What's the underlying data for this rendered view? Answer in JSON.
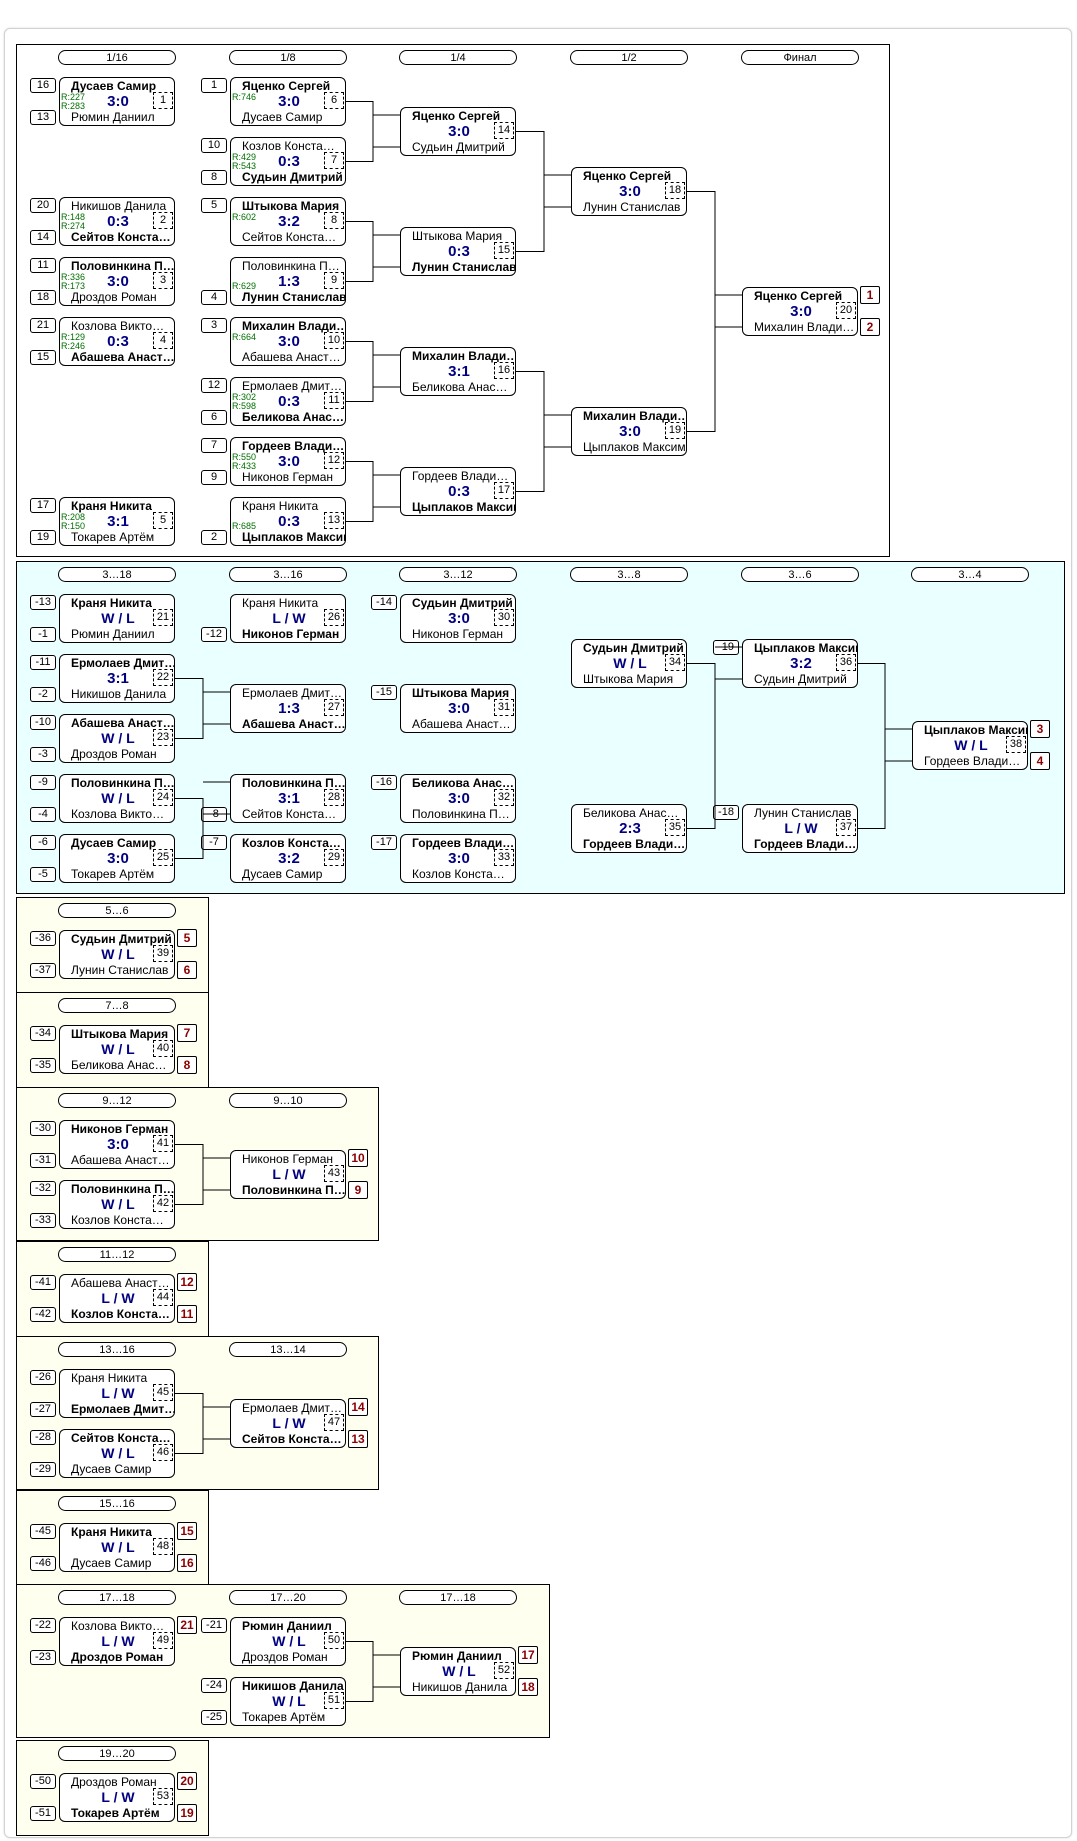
{
  "sections": [
    {
      "bg": "white",
      "rounds": [
        "1/16",
        "1/8",
        "1/4",
        "1/2",
        "Финал"
      ],
      "matches": [
        {
          "t": "Дусаев Самир",
          "tr": "R:227",
          "b": "Рюмин Даниил",
          "br": "R:283",
          "score": "3:0",
          "num": "1",
          "win": "t",
          "ts": "16",
          "bs": "13"
        },
        {
          "t": "Никишов Данила",
          "tr": "R:148",
          "b": "Сейтов Конста…",
          "br": "R:274",
          "score": "0:3",
          "num": "2",
          "win": "b",
          "ts": "20",
          "bs": "14"
        },
        {
          "t": "Половинкина П…",
          "tr": "R:336",
          "b": "Дроздов Роман",
          "br": "R:173",
          "score": "3:0",
          "num": "3",
          "win": "t",
          "ts": "11",
          "bs": "18"
        },
        {
          "t": "Козлова Викто…",
          "tr": "R:129",
          "b": "Абашева Анаст…",
          "br": "R:246",
          "score": "0:3",
          "num": "4",
          "win": "b",
          "ts": "21",
          "bs": "15"
        },
        {
          "t": "Краня Никита",
          "tr": "R:208",
          "b": "Токарев Артём",
          "br": "R:150",
          "score": "3:1",
          "num": "5",
          "win": "t",
          "ts": "17",
          "bs": "19"
        },
        {
          "t": "Яценко Сергей",
          "tr": "R:746",
          "b": "Дусаев Самир",
          "br": "",
          "score": "3:0",
          "num": "6",
          "win": "t",
          "ts": "1",
          "bs": ""
        },
        {
          "t": "Козлов Конста…",
          "tr": "R:429",
          "b": "Судьин Дмитрий",
          "br": "R:543",
          "score": "0:3",
          "num": "7",
          "win": "b",
          "ts": "10",
          "bs": "8"
        },
        {
          "t": "Штыкова Мария",
          "tr": "R:602",
          "b": "Сейтов Конста…",
          "br": "",
          "score": "3:2",
          "num": "8",
          "win": "t",
          "ts": "5",
          "bs": ""
        },
        {
          "t": "Половинкина П…",
          "tr": "",
          "b": "Лунин Станислав",
          "br": "R:629",
          "score": "1:3",
          "num": "9",
          "win": "b",
          "ts": "",
          "bs": "4"
        },
        {
          "t": "Михалин Влади…",
          "tr": "R:664",
          "b": "Абашева Анаст…",
          "br": "",
          "score": "3:0",
          "num": "10",
          "win": "t",
          "ts": "3",
          "bs": ""
        },
        {
          "t": "Ермолаев Дмит…",
          "tr": "R:302",
          "b": "Беликова Анас…",
          "br": "R:598",
          "score": "0:3",
          "num": "11",
          "win": "b",
          "ts": "12",
          "bs": "6"
        },
        {
          "t": "Гордеев Влади…",
          "tr": "R:550",
          "b": "Никонов Герман",
          "br": "R:433",
          "score": "3:0",
          "num": "12",
          "win": "t",
          "ts": "7",
          "bs": "9"
        },
        {
          "t": "Краня Никита",
          "tr": "",
          "b": "Цыплаков Максим",
          "br": "R:685",
          "score": "0:3",
          "num": "13",
          "win": "b",
          "ts": "",
          "bs": "2"
        },
        {
          "t": "Яценко Сергей",
          "b": "Судьин Дмитрий",
          "score": "3:0",
          "num": "14",
          "win": "t"
        },
        {
          "t": "Штыкова Мария",
          "b": "Лунин Станислав",
          "score": "0:3",
          "num": "15",
          "win": "b"
        },
        {
          "t": "Михалин Влади…",
          "b": "Беликова Анас…",
          "score": "3:1",
          "num": "16",
          "win": "t"
        },
        {
          "t": "Гордеев Влади…",
          "b": "Цыплаков Максим",
          "score": "0:3",
          "num": "17",
          "win": "b"
        },
        {
          "t": "Яценко Сергей",
          "b": "Лунин Станислав",
          "score": "3:0",
          "num": "18",
          "win": "t"
        },
        {
          "t": "Михалин Влади…",
          "b": "Цыплаков Максим",
          "score": "3:0",
          "num": "19",
          "win": "t"
        },
        {
          "t": "Яценко Сергей",
          "b": "Михалин Влади…",
          "score": "3:0",
          "num": "20",
          "win": "t",
          "pt": "1",
          "pb": "2"
        }
      ]
    },
    {
      "bg": "blue",
      "rounds": [
        "3…18",
        "3…16",
        "3…12",
        "3…8",
        "3…6",
        "3…4"
      ],
      "matches": [
        {
          "t": "Краня Никита",
          "b": "Рюмин Даниил",
          "score": "W / L",
          "num": "21",
          "win": "t",
          "ts": "-13",
          "bs": "-1"
        },
        {
          "t": "Ермолаев Дмит…",
          "b": "Никишов Данила",
          "score": "3:1",
          "num": "22",
          "win": "t",
          "ts": "-11",
          "bs": "-2"
        },
        {
          "t": "Абашева Анаст…",
          "b": "Дроздов Роман",
          "score": "W / L",
          "num": "23",
          "win": "t",
          "ts": "-10",
          "bs": "-3"
        },
        {
          "t": "Половинкина П…",
          "b": "Козлова Викто…",
          "score": "W / L",
          "num": "24",
          "win": "t",
          "ts": "-9",
          "bs": "-4"
        },
        {
          "t": "Дусаев Самир",
          "b": "Токарев Артём",
          "score": "3:0",
          "num": "25",
          "win": "t",
          "ts": "-6",
          "bs": "-5"
        },
        {
          "t": "Краня Никита",
          "b": "Никонов Герман",
          "score": "L / W",
          "num": "26",
          "win": "b",
          "ts": "",
          "bs": "-12"
        },
        {
          "t": "Ермолаев Дмит…",
          "b": "Абашева Анаст…",
          "score": "1:3",
          "num": "27",
          "win": "b"
        },
        {
          "t": "Половинкина П…",
          "b": "Сейтов Конста…",
          "score": "3:1",
          "num": "28",
          "win": "t",
          "ts": "",
          "bs": "-8"
        },
        {
          "t": "Козлов Конста…",
          "b": "Дусаев Самир",
          "score": "3:2",
          "num": "29",
          "win": "t",
          "ts": "-7",
          "bs": ""
        },
        {
          "t": "Судьин Дмитрий",
          "b": "Никонов Герман",
          "score": "3:0",
          "num": "30",
          "win": "t",
          "ts": "-14",
          "bs": ""
        },
        {
          "t": "Штыкова Мария",
          "b": "Абашева Анаст…",
          "score": "3:0",
          "num": "31",
          "win": "t",
          "ts": "-15",
          "bs": ""
        },
        {
          "t": "Беликова Анас…",
          "b": "Половинкина П…",
          "score": "3:0",
          "num": "32",
          "win": "t",
          "ts": "-16",
          "bs": ""
        },
        {
          "t": "Гордеев Влади…",
          "b": "Козлов Конста…",
          "score": "3:0",
          "num": "33",
          "win": "t",
          "ts": "-17",
          "bs": ""
        },
        {
          "t": "Судьин Дмитрий",
          "b": "Штыкова Мария",
          "score": "W / L",
          "num": "34",
          "win": "t"
        },
        {
          "t": "Беликова Анас…",
          "b": "Гордеев Влади…",
          "score": "2:3",
          "num": "35",
          "win": "b"
        },
        {
          "t": "Цыплаков Максим",
          "b": "Судьин Дмитрий",
          "score": "3:2",
          "num": "36",
          "win": "t",
          "ts": "-19",
          "bs": ""
        },
        {
          "t": "Лунин Станислав",
          "b": "Гордеев Влади…",
          "score": "L / W",
          "num": "37",
          "win": "b",
          "ts": "-18",
          "bs": ""
        },
        {
          "t": "Цыплаков Максим",
          "b": "Гордеев Влади…",
          "score": "W / L",
          "num": "38",
          "win": "t",
          "pt": "3",
          "pb": "4"
        }
      ]
    },
    {
      "bg": "yellow",
      "rounds": [
        "5…6"
      ],
      "matches": [
        {
          "t": "Судьин Дмитрий",
          "b": "Лунин Станислав",
          "score": "W / L",
          "num": "39",
          "win": "t",
          "ts": "-36",
          "bs": "-37",
          "pt": "5",
          "pb": "6"
        }
      ]
    },
    {
      "bg": "yellow",
      "rounds": [
        "7…8"
      ],
      "matches": [
        {
          "t": "Штыкова Мария",
          "b": "Беликова Анас…",
          "score": "W / L",
          "num": "40",
          "win": "t",
          "ts": "-34",
          "bs": "-35",
          "pt": "7",
          "pb": "8"
        }
      ]
    },
    {
      "bg": "yellow",
      "rounds": [
        "9…12",
        "9…10"
      ],
      "matches": [
        {
          "t": "Никонов Герман",
          "b": "Абашева Анаст…",
          "score": "3:0",
          "num": "41",
          "win": "t",
          "ts": "-30",
          "bs": "-31"
        },
        {
          "t": "Половинкина П…",
          "b": "Козлов Конста…",
          "score": "W / L",
          "num": "42",
          "win": "t",
          "ts": "-32",
          "bs": "-33"
        },
        {
          "t": "Никонов Герман",
          "b": "Половинкина П…",
          "score": "L / W",
          "num": "43",
          "win": "b",
          "pt": "10",
          "pb": "9"
        }
      ]
    },
    {
      "bg": "yellow",
      "rounds": [
        "11…12"
      ],
      "matches": [
        {
          "t": "Абашева Анаст…",
          "b": "Козлов Конста…",
          "score": "L / W",
          "num": "44",
          "win": "b",
          "ts": "-41",
          "bs": "-42",
          "pt": "12",
          "pb": "11"
        }
      ]
    },
    {
      "bg": "yellow",
      "rounds": [
        "13…16",
        "13…14"
      ],
      "matches": [
        {
          "t": "Краня Никита",
          "b": "Ермолаев Дмит…",
          "score": "L / W",
          "num": "45",
          "win": "b",
          "ts": "-26",
          "bs": "-27"
        },
        {
          "t": "Сейтов Конста…",
          "b": "Дусаев Самир",
          "score": "W / L",
          "num": "46",
          "win": "t",
          "ts": "-28",
          "bs": "-29"
        },
        {
          "t": "Ермолаев Дмит…",
          "b": "Сейтов Конста…",
          "score": "L / W",
          "num": "47",
          "win": "b",
          "pt": "14",
          "pb": "13"
        }
      ]
    },
    {
      "bg": "yellow",
      "rounds": [
        "15…16"
      ],
      "matches": [
        {
          "t": "Краня Никита",
          "b": "Дусаев Самир",
          "score": "W / L",
          "num": "48",
          "win": "t",
          "ts": "-45",
          "bs": "-46",
          "pt": "15",
          "pb": "16"
        }
      ]
    },
    {
      "bg": "yellow",
      "rounds": [
        "17…18",
        "17…20",
        "17…18"
      ],
      "matches": [
        {
          "t": "Козлова Викто…",
          "b": "Дроздов Роман",
          "score": "L / W",
          "num": "49",
          "win": "b",
          "ts": "-22",
          "bs": "-23",
          "pt": "21",
          "pb": ""
        },
        {
          "t": "Рюмин Даниил",
          "b": "Дроздов Роман",
          "score": "W / L",
          "num": "50",
          "win": "t",
          "ts": "-21",
          "bs": ""
        },
        {
          "t": "Никишов Данила",
          "b": "Токарев Артём",
          "score": "W / L",
          "num": "51",
          "win": "t",
          "ts": "-24",
          "bs": "-25"
        },
        {
          "t": "Рюмин Даниил",
          "b": "Никишов Данила",
          "score": "W / L",
          "num": "52",
          "win": "t",
          "pt": "17",
          "pb": "18"
        }
      ]
    },
    {
      "bg": "yellow",
      "rounds": [
        "19…20"
      ],
      "matches": [
        {
          "t": "Дроздов Роман",
          "b": "Токарев Артём",
          "score": "L / W",
          "num": "53",
          "win": "b",
          "ts": "-50",
          "bs": "-51",
          "pt": "20",
          "pb": "19"
        }
      ]
    }
  ]
}
